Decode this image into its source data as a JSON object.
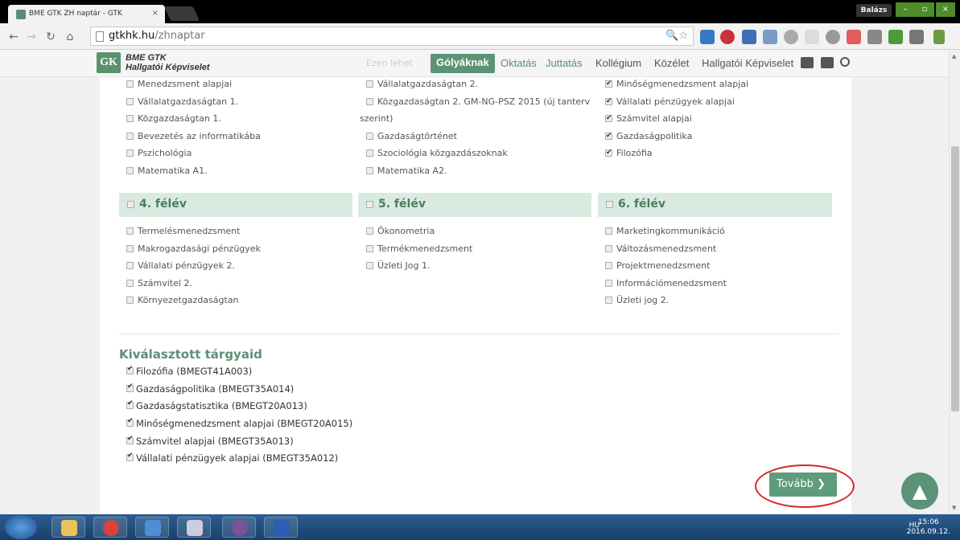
{
  "browser": {
    "tab_title": "BME GTK ZH naptár - GTK",
    "tab_close": "×",
    "user": "Balázs",
    "url_host": "gtkhk.hu",
    "url_path": "/zhnaptar",
    "omni_icons": "🔍☆"
  },
  "site": {
    "logo_mark": "GK",
    "logo_line1": "BME GTK",
    "logo_line2": "Hallgatói Képviselet",
    "ghost": "Ezen lehet",
    "nav": {
      "active": "Gólyáknak",
      "oktatas": "Oktatás",
      "juttatas": "Juttatás",
      "kollegium": "Kollégium",
      "kozelet": "Közélet",
      "hk": "Hallgatói Képviselet"
    }
  },
  "columns": {
    "col1_items": [
      {
        "label": "Menedzsment alapjai",
        "checked": false
      },
      {
        "label": "Vállalatgazdaságtan 1.",
        "checked": false
      },
      {
        "label": "Közgazdaságtan 1.",
        "checked": false
      },
      {
        "label": "Bevezetés az informatikába",
        "checked": false
      },
      {
        "label": "Pszichológia",
        "checked": false
      },
      {
        "label": "Matematika A1.",
        "checked": false
      }
    ],
    "col2_items": [
      {
        "label": "Vállalatgazdaságtan 2.",
        "checked": false
      },
      {
        "label": "Közgazdaságtan 2. GM-NG-PSZ 2015 (új tanterv",
        "checked": false
      }
    ],
    "col2_wrap": "szerint)",
    "col2_items_b": [
      {
        "label": "Gazdaságtörténet",
        "checked": false
      },
      {
        "label": "Szociológia közgazdászoknak",
        "checked": false
      },
      {
        "label": "Matematika A2.",
        "checked": false
      }
    ],
    "col3_items": [
      {
        "label": "Minőségmenedzsment alapjai",
        "checked": true
      },
      {
        "label": "Vállalati pénzügyek alapjai",
        "checked": true
      },
      {
        "label": "Számvitel alapjai",
        "checked": true
      },
      {
        "label": "Gazdaságpolitika",
        "checked": true
      },
      {
        "label": "Filozófia",
        "checked": true
      }
    ]
  },
  "semesters": {
    "s4": "4. félév",
    "s5": "5. félév",
    "s6": "6. félév",
    "s4_items": [
      "Termelésmenedzsment",
      "Makrogazdasági pénzügyek",
      "Vállalati pénzügyek 2.",
      "Számvitel 2.",
      "Környezetgazdaságtan"
    ],
    "s5_items": [
      "Ökonometria",
      "Termékmenedzsment",
      "Üzleti Jog 1."
    ],
    "s6_items": [
      "Marketingkommunikáció",
      "Változásmenedzsment",
      "Projektmenedzsment",
      "Információmenedzsment",
      "Üzleti jog 2."
    ]
  },
  "selected": {
    "title": "Kiválasztott tárgyaid",
    "items": [
      "Filozófia (BMEGT41A003)",
      "Gazdaságpolitika (BMEGT35A014)",
      "Gazdaságstatisztika (BMEGT20A013)",
      "Minőségmenedzsment alapjai (BMEGT20A015)",
      "Számvitel alapjai (BMEGT35A013)",
      "Vállalati pénzügyek alapjai (BMEGT35A012)"
    ]
  },
  "actions": {
    "next": "Tovább",
    "next_chevron": "❯",
    "to_top": "▲"
  },
  "taskbar": {
    "lang": "HU",
    "time": "15:06",
    "date": "2016.09.12."
  }
}
